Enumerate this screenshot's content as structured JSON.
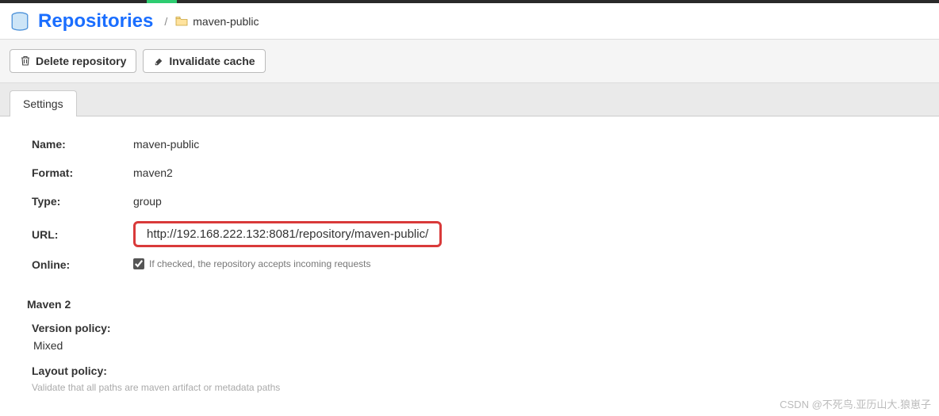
{
  "header": {
    "title": "Repositories",
    "breadcrumb_item": "maven-public"
  },
  "actions": {
    "delete_label": "Delete repository",
    "invalidate_label": "Invalidate cache"
  },
  "tabs": {
    "settings_label": "Settings"
  },
  "fields": {
    "name": {
      "label": "Name:",
      "value": "maven-public"
    },
    "format": {
      "label": "Format:",
      "value": "maven2"
    },
    "type": {
      "label": "Type:",
      "value": "group"
    },
    "url": {
      "label": "URL:",
      "value": "http://192.168.222.132:8081/repository/maven-public/"
    },
    "online": {
      "label": "Online:",
      "checked": true,
      "hint": "If checked, the repository accepts incoming requests"
    }
  },
  "maven2": {
    "heading": "Maven 2",
    "version_policy": {
      "label": "Version policy:",
      "value": "Mixed"
    },
    "layout_policy": {
      "label": "Layout policy:",
      "hint": "Validate that all paths are maven artifact or metadata paths"
    }
  },
  "watermark": "CSDN @不死鸟.亚历山大.狼崽子"
}
